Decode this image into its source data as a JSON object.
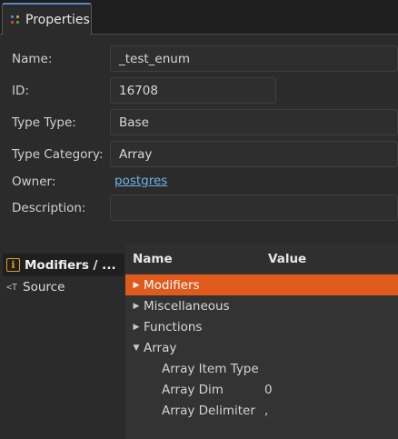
{
  "tab": {
    "title": "Properties"
  },
  "form": {
    "name_label": "Name:",
    "name_value": "_test_enum",
    "id_label": "ID:",
    "id_value": "16708",
    "type_type_label": "Type Type:",
    "type_type_value": "Base",
    "type_category_label": "Type Category:",
    "type_category_value": "Array",
    "owner_label": "Owner:",
    "owner_value": "postgres",
    "description_label": "Description:",
    "description_value": ""
  },
  "side_tabs": [
    {
      "label": "Modifiers / ...",
      "icon": "info-icon",
      "active": true
    },
    {
      "label": "Source",
      "icon": "source-icon",
      "active": false
    }
  ],
  "tree": {
    "col_name": "Name",
    "col_value": "Value",
    "groups": [
      {
        "label": "Modifiers",
        "expanded": false,
        "selected": true
      },
      {
        "label": "Miscellaneous",
        "expanded": false,
        "selected": false
      },
      {
        "label": "Functions",
        "expanded": false,
        "selected": false
      },
      {
        "label": "Array",
        "expanded": true,
        "selected": false
      }
    ],
    "array_children": [
      {
        "name": "Array Item Type",
        "value": ""
      },
      {
        "name": "Array Dim",
        "value": "0"
      },
      {
        "name": "Array Delimiter",
        "value": ","
      }
    ]
  },
  "colors": {
    "selection": "#e05a1b",
    "link": "#6cb6e8",
    "accent": "#5a87c5"
  }
}
